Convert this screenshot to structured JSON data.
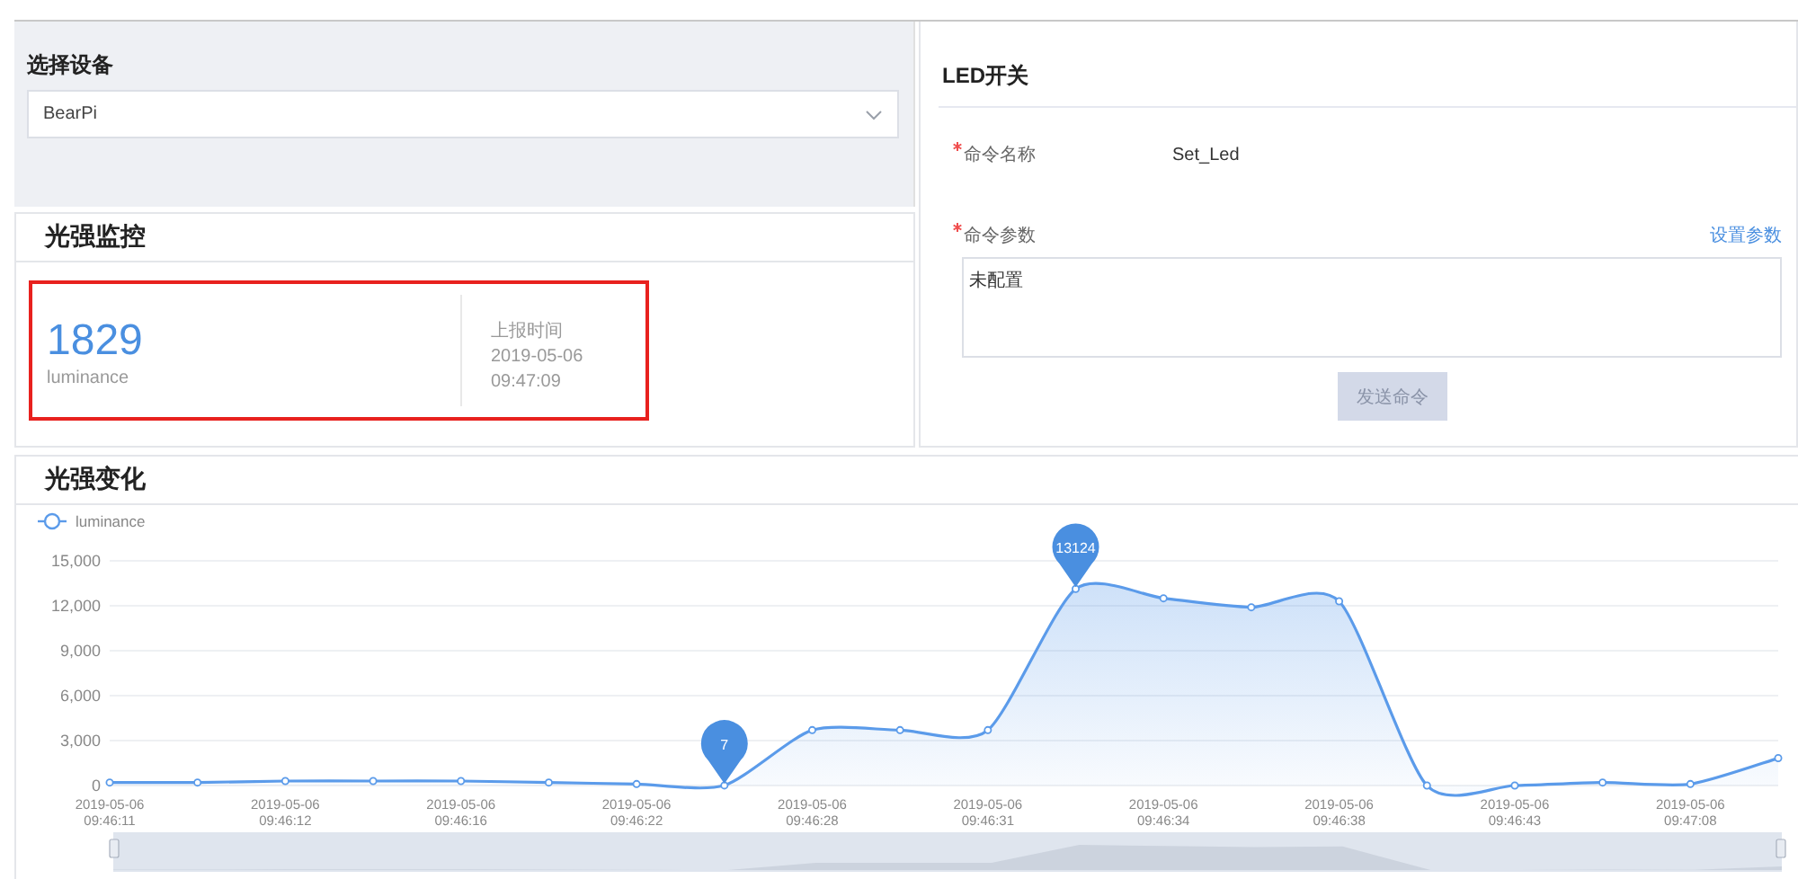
{
  "device_select": {
    "label": "选择设备",
    "value": "BearPi"
  },
  "monitor": {
    "title": "光强监控",
    "reading": "1829",
    "unit": "luminance",
    "time_label": "上报时间",
    "date": "2019-05-06",
    "time": "09:47:09",
    "highlighted": true
  },
  "led": {
    "title": "LED开关",
    "command": {
      "label": "命令名称",
      "required": true,
      "value": "Set_Led"
    },
    "params": {
      "label": "命令参数",
      "required": true,
      "link": "设置参数",
      "value": "未配置"
    },
    "send_button": {
      "label": "发送命令",
      "disabled": true
    }
  },
  "trend": {
    "title": "光强变化",
    "chart_data": {
      "type": "area",
      "categories": [
        "2019-05-06 09:46:11",
        null,
        "2019-05-06 09:46:12",
        null,
        "2019-05-06 09:46:16",
        null,
        "2019-05-06 09:46:22",
        null,
        "2019-05-06 09:46:28",
        null,
        "2019-05-06 09:46:31",
        null,
        "2019-05-06 09:46:34",
        null,
        "2019-05-06 09:46:38",
        null,
        "2019-05-06 09:46:43",
        null,
        "2019-05-06 09:47:08",
        null
      ],
      "series": [
        {
          "name": "luminance",
          "color": "#5b9bea",
          "values": [
            200,
            200,
            300,
            300,
            300,
            200,
            100,
            7,
            3700,
            3700,
            3700,
            13124,
            12500,
            11900,
            12300,
            0,
            0,
            200,
            100,
            1829
          ]
        }
      ],
      "ylim": [
        0,
        15000
      ],
      "yticks": [
        {
          "value": 0,
          "label": "0"
        },
        {
          "value": 3000,
          "label": "3,000"
        },
        {
          "value": 6000,
          "label": "6,000"
        },
        {
          "value": 9000,
          "label": "9,000"
        },
        {
          "value": 12000,
          "label": "12,000"
        },
        {
          "value": 15000,
          "label": "15,000"
        }
      ],
      "grid": true,
      "annotations": [
        {
          "y": 7,
          "text": "7"
        },
        {
          "y": 13124,
          "text": "13124"
        }
      ]
    }
  }
}
